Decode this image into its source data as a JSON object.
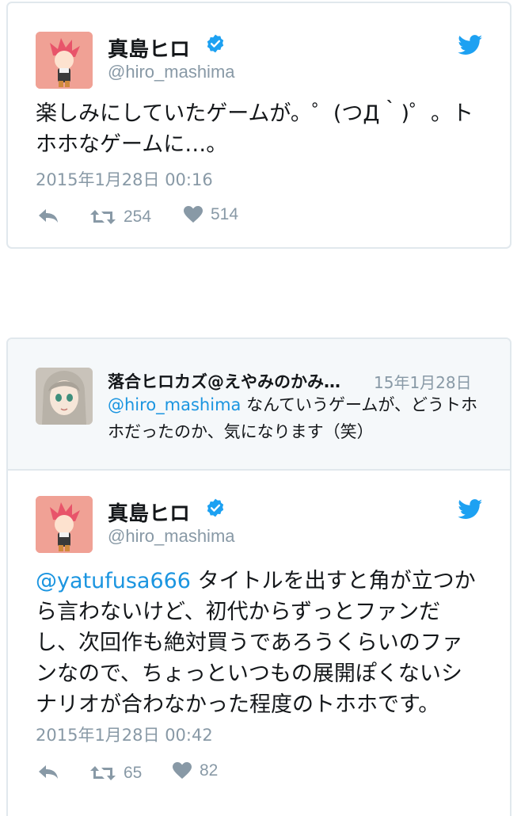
{
  "tweet1": {
    "name": "真島ヒロ",
    "handle": "@hiro_mashima",
    "text": "楽しみにしていたゲームが。゜(つД｀)゜。トホホなゲームに…。",
    "timestamp": "2015年1月28日 00:16",
    "retweets": "254",
    "likes": "514"
  },
  "context_tweet": {
    "name": "落合ヒロカズ@えやみのかみ…",
    "date": "15年1月28日",
    "mention": "@hiro_mashima",
    "text": " なんていうゲームが、どうトホホだったのか、気になります（笑）"
  },
  "tweet2": {
    "name": "真島ヒロ",
    "handle": "@hiro_mashima",
    "mention": "@yatufusa666",
    "text": " タイトルを出すと角が立つから言わないけど、初代からずっとファンだし、次回作も絶対買うであろうくらいのファンなので、ちょっといつもの展開ぽくないシナリオが合わなかった程度のトホホです。",
    "timestamp": "2015年1月28日 00:42",
    "retweets": "65",
    "likes": "82"
  },
  "colors": {
    "accent": "#1b95e0",
    "twitter_blue": "#1da1f2",
    "muted": "#8899a6",
    "border": "#e1e8ed",
    "context_bg": "#f5f8fa"
  },
  "icons": [
    "verified-badge-icon",
    "twitter-bird-icon",
    "reply-icon",
    "retweet-icon",
    "heart-icon"
  ]
}
